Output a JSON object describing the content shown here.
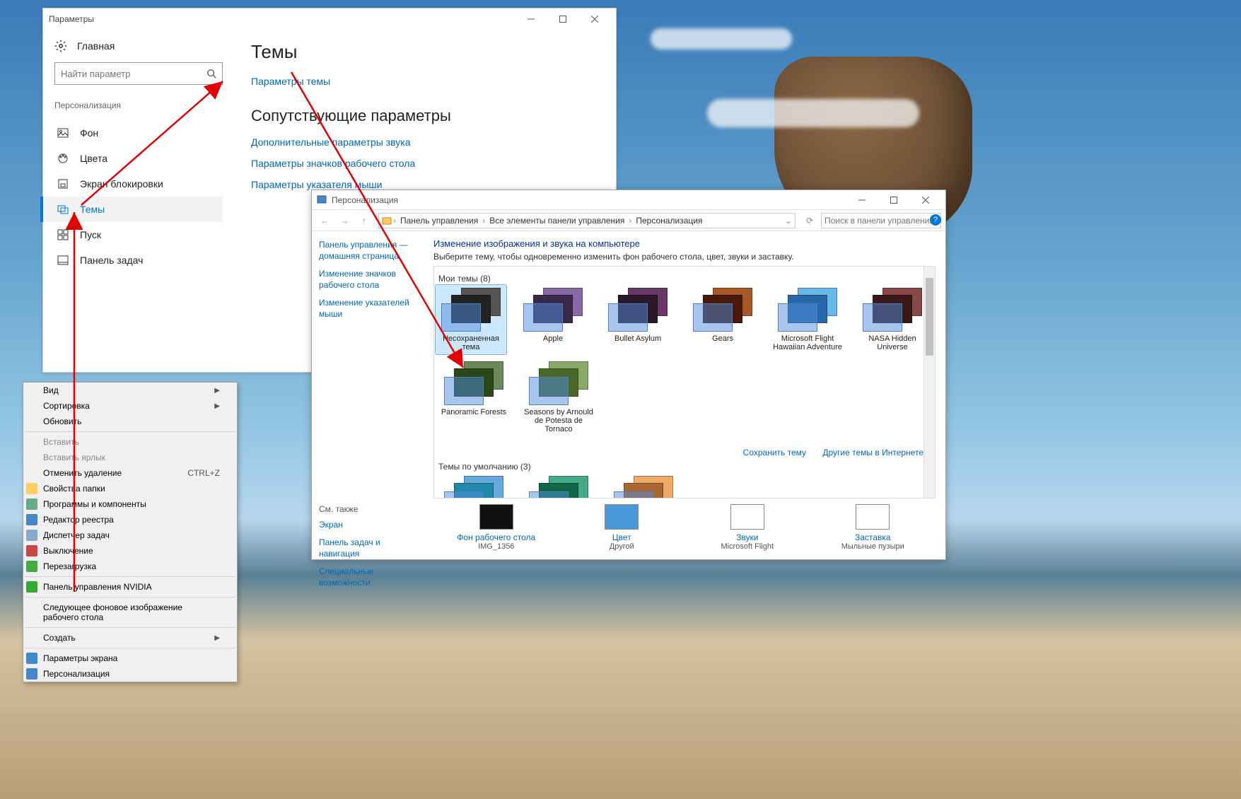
{
  "settings": {
    "title": "Параметры",
    "home": "Главная",
    "search_placeholder": "Найти параметр",
    "section": "Персонализация",
    "items": [
      {
        "label": "Фон"
      },
      {
        "label": "Цвета"
      },
      {
        "label": "Экран блокировки"
      },
      {
        "label": "Темы"
      },
      {
        "label": "Пуск"
      },
      {
        "label": "Панель задач"
      }
    ],
    "main_heading": "Темы",
    "theme_settings_link": "Параметры темы",
    "related_heading": "Сопутствующие параметры",
    "related_links": [
      "Дополнительные параметры звука",
      "Параметры значков рабочего стола",
      "Параметры указателя мыши"
    ]
  },
  "ctx": {
    "items": [
      {
        "label": "Вид",
        "sub": true
      },
      {
        "label": "Сортировка",
        "sub": true
      },
      {
        "label": "Обновить"
      },
      {
        "sep": true
      },
      {
        "label": "Вставить",
        "disabled": true
      },
      {
        "label": "Вставить ярлык",
        "disabled": true
      },
      {
        "label": "Отменить удаление",
        "shortcut": "CTRL+Z"
      },
      {
        "label": "Свойства папки",
        "icon": "folder"
      },
      {
        "label": "Программы и компоненты",
        "icon": "programs"
      },
      {
        "label": "Редактор реестра",
        "icon": "regedit"
      },
      {
        "label": "Диспетчер задач",
        "icon": "taskmgr"
      },
      {
        "label": "Выключение",
        "icon": "shutdown"
      },
      {
        "label": "Перезагрузка",
        "icon": "restart"
      },
      {
        "sep": true
      },
      {
        "label": "Панель управления NVIDIA",
        "icon": "nvidia"
      },
      {
        "sep": true
      },
      {
        "label": "Следующее фоновое изображение рабочего стола"
      },
      {
        "sep": true
      },
      {
        "label": "Создать",
        "sub": true
      },
      {
        "sep": true
      },
      {
        "label": "Параметры экрана",
        "icon": "display"
      },
      {
        "label": "Персонализация",
        "icon": "personalize"
      }
    ]
  },
  "pers": {
    "title": "Персонализация",
    "breadcrumb": [
      "Панель управления",
      "Все элементы панели управления",
      "Персонализация"
    ],
    "search_placeholder": "Поиск в панели управления",
    "left_links": [
      "Панель управления — домашняя страница",
      "Изменение значков рабочего стола",
      "Изменение указателей мыши"
    ],
    "see_also": "См. также",
    "see_also_links": [
      "Экран",
      "Панель задач и навигация",
      "Специальные возможности"
    ],
    "heading": "Изменение изображения и звука на компьютере",
    "desc": "Выберите тему, чтобы одновременно изменить фон рабочего стола, цвет, звуки и заставку.",
    "my_themes": "Мои темы (8)",
    "themes_row1": [
      {
        "name": "Несохраненная тема",
        "c1": "#4a88c8",
        "c2": "#222",
        "c3": "#555"
      },
      {
        "name": "Apple",
        "c1": "#6a4a88",
        "c2": "#3a2a4a",
        "c3": "#8a68a8"
      },
      {
        "name": "Bullet Asylum",
        "c1": "#4a2848",
        "c2": "#2a1828",
        "c3": "#6a3868"
      },
      {
        "name": "Gears",
        "c1": "#8a3818",
        "c2": "#4a1808",
        "c3": "#a85828"
      },
      {
        "name": "Microsoft Flight Hawaiian Adventure",
        "c1": "#4898c8",
        "c2": "#2868a8",
        "c3": "#68b8e8"
      },
      {
        "name": "NASA Hidden Universe",
        "c1": "#682828",
        "c2": "#381818",
        "c3": "#884848"
      }
    ],
    "themes_row2": [
      {
        "name": "Panoramic Forests",
        "c1": "#4a6838",
        "c2": "#2a4818",
        "c3": "#6a8858"
      },
      {
        "name": "Seasons by Arnould de Potesta de Tornaco",
        "c1": "#6a8848",
        "c2": "#4a6828",
        "c3": "#8aa868"
      }
    ],
    "save_theme": "Сохранить тему",
    "more_themes": "Другие темы в Интернете",
    "default_themes": "Темы по умолчанию (3)",
    "bottom": [
      {
        "link": "Фон рабочего стола",
        "sub": "IMG_1356",
        "bg": "#111"
      },
      {
        "link": "Цвет",
        "sub": "Другой",
        "bg": "#4a98d8"
      },
      {
        "link": "Звуки",
        "sub": "Microsoft Flight",
        "bg": "#fff"
      },
      {
        "link": "Заставка",
        "sub": "Мыльные пузыри",
        "bg": "#fff"
      }
    ]
  }
}
